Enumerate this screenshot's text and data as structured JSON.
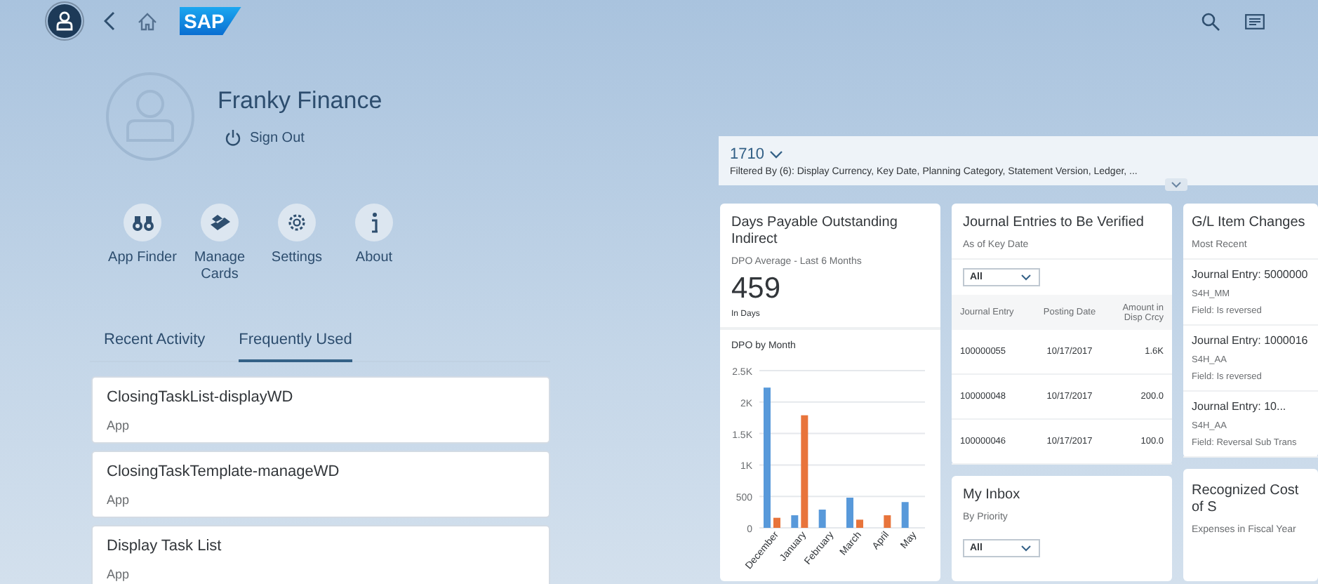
{
  "shell": {
    "logo": "SAP"
  },
  "user": {
    "name": "Franky Finance",
    "sign_out": "Sign Out"
  },
  "actions": [
    {
      "label": "App Finder",
      "kind": "finder"
    },
    {
      "label": "Manage Cards",
      "kind": "cards"
    },
    {
      "label": "Settings",
      "kind": "settings"
    },
    {
      "label": "About",
      "kind": "about"
    }
  ],
  "tabs": [
    {
      "label": "Recent Activity",
      "selected": false
    },
    {
      "label": "Frequently Used",
      "selected": true
    }
  ],
  "apps": [
    {
      "title": "ClosingTaskList-displayWD",
      "type": "App"
    },
    {
      "title": "ClosingTaskTemplate-manageWD",
      "type": "App"
    },
    {
      "title": "Display Task List",
      "type": "App"
    }
  ],
  "filter": {
    "variant": "1710",
    "summary": "Filtered By (6): Display Currency, Key Date, Planning Category, Statement Version, Ledger, ..."
  },
  "dpo_card": {
    "title": "Days Payable Outstanding Indirect",
    "subtitle": "DPO Average - Last 6 Months",
    "kpi": "459",
    "unit": "In Days",
    "chart_title": "DPO by Month",
    "chart_data": {
      "type": "bar",
      "categories": [
        "December",
        "January",
        "February",
        "March",
        "April",
        "May"
      ],
      "series": [
        {
          "color": "#5899da",
          "values": [
            2230,
            200,
            290,
            480,
            null,
            410
          ]
        },
        {
          "color": "#e8743b",
          "values": [
            160,
            1790,
            null,
            130,
            200,
            null
          ]
        }
      ],
      "ylim": [
        0,
        2500
      ],
      "grid": true,
      "yticks": [
        0,
        {
          "value": 500,
          "label": "500"
        },
        {
          "value": 1000,
          "label": "1K"
        },
        {
          "value": 1500,
          "label": "1.5K"
        },
        {
          "value": 2000,
          "label": "2K"
        },
        {
          "value": 2500,
          "label": "2.5K"
        }
      ]
    }
  },
  "journal_card": {
    "title": "Journal Entries to Be Verified",
    "subtitle": "As of Key Date",
    "dropdown": "All",
    "columns": [
      "Journal Entry",
      "Posting Date",
      "Amount in Disp Crcy"
    ],
    "rows": [
      [
        "100000055",
        "10/17/2017",
        "1.6K"
      ],
      [
        "100000048",
        "10/17/2017",
        "200.0"
      ],
      [
        "100000046",
        "10/17/2017",
        "100.0"
      ]
    ]
  },
  "inbox_card": {
    "title": "My Inbox",
    "subtitle": "By Priority",
    "dropdown": "All"
  },
  "gl_card": {
    "title": "G/L Item Changes",
    "subtitle": "Most Recent",
    "items": [
      {
        "title": "Journal Entry: 5000000",
        "user": "S4H_MM",
        "field": "Field: Is reversed"
      },
      {
        "title": "Journal Entry: 1000016",
        "user": "S4H_AA",
        "field": "Field: Is reversed"
      },
      {
        "title": "Journal Entry: 10...",
        "user": "S4H_AA",
        "field": "Field: Reversal Sub Trans"
      }
    ]
  },
  "cost_card": {
    "title": "Recognized Cost of S",
    "subtitle": "Expenses in Fiscal Year"
  }
}
